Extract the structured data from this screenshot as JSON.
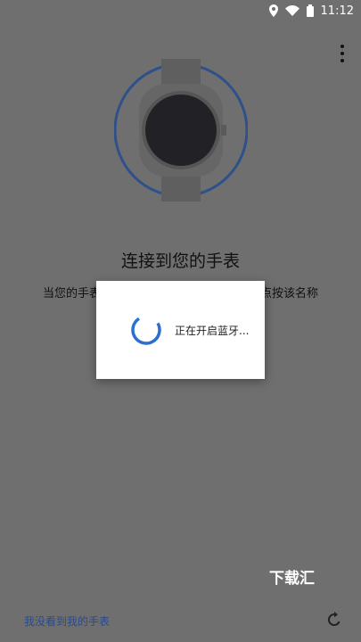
{
  "status_bar": {
    "time": "11:12"
  },
  "content": {
    "title": "连接到您的手表",
    "instruction_left": "当您的手表",
    "instruction_right": "点按该名称"
  },
  "dialog": {
    "message": "正在开启蓝牙..."
  },
  "watermark": "下载汇",
  "footer": {
    "link": "我没看到我的手表"
  },
  "colors": {
    "accent": "#2b6fd0",
    "ring": "#30508a",
    "overlay": "#6f6f6f"
  }
}
